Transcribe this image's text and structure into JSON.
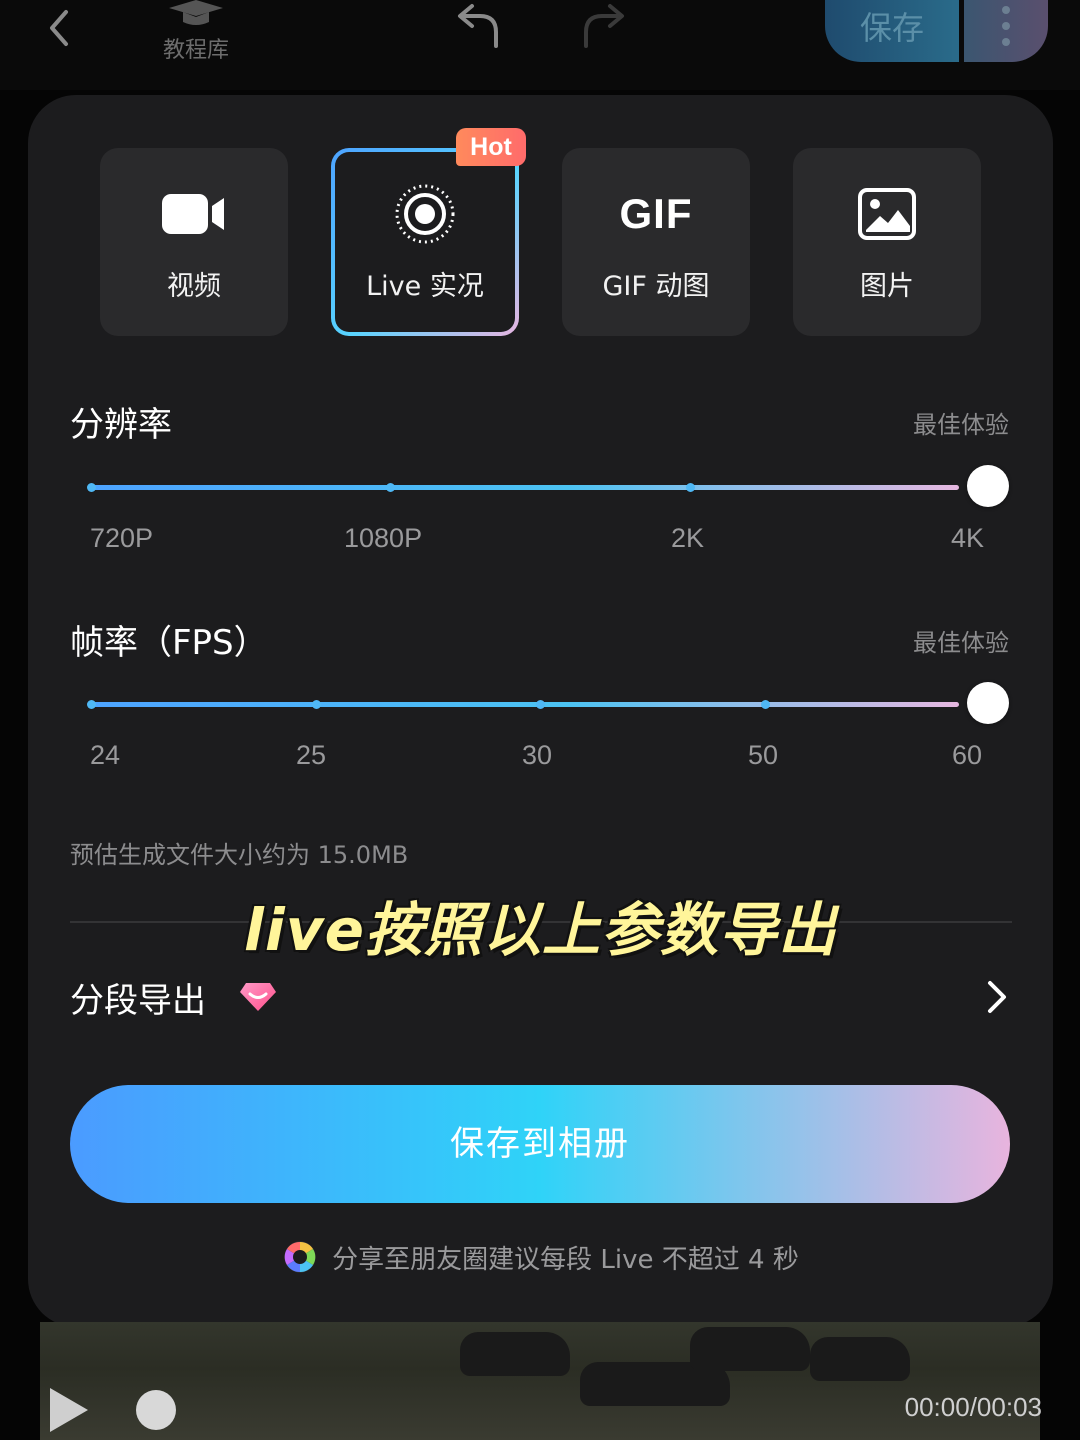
{
  "topbar": {
    "tutorial_label": "教程库",
    "save_label": "保存"
  },
  "export_types": [
    {
      "label": "视频",
      "icon": "video-camera-icon"
    },
    {
      "label": "Live 实况",
      "icon": "live-photo-icon",
      "badge": "Hot",
      "selected": true
    },
    {
      "label": "GIF 动图",
      "icon": "gif-icon",
      "icon_text": "GIF"
    },
    {
      "label": "图片",
      "icon": "image-icon"
    }
  ],
  "resolution": {
    "title": "分辨率",
    "hint": "最佳体验",
    "options": [
      "720P",
      "1080P",
      "2K",
      "4K"
    ],
    "selected": "4K"
  },
  "fps": {
    "title": "帧率（FPS）",
    "hint": "最佳体验",
    "options": [
      "24",
      "25",
      "30",
      "50",
      "60"
    ],
    "selected": "60"
  },
  "size_note": "预估生成文件大小约为 15.0MB",
  "overlay_caption": "live按照以上参数导出",
  "segment_export": {
    "label": "分段导出"
  },
  "save_button": "保存到相册",
  "tip": "分享至朋友圈建议每段 Live 不超过 4 秒",
  "player": {
    "timecode": "00:00/00:03"
  },
  "colors": {
    "accent_start": "#4b9bff",
    "accent_mid": "#2fd3f8",
    "accent_end": "#e8b4de",
    "panel_bg": "#1c1c1e",
    "hot_badge": "#ff7a62",
    "overlay_text": "#fff59a"
  }
}
